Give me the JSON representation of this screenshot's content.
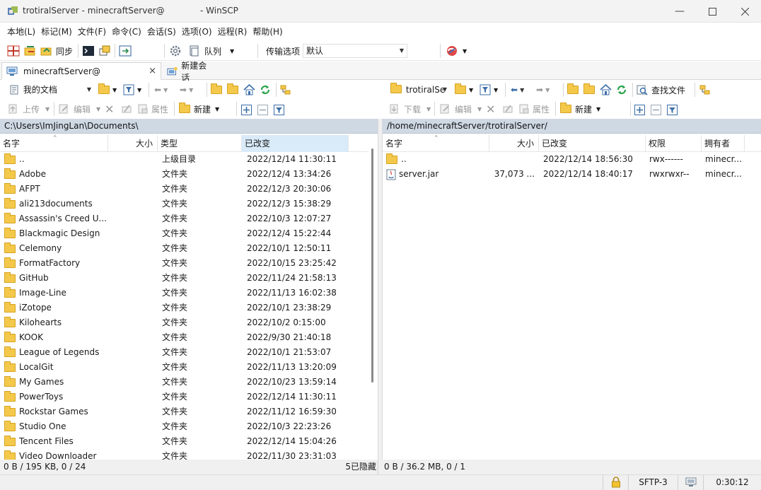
{
  "window": {
    "title_left": "trotiralServer - minecraftServer@",
    "title_right": "- WinSCP"
  },
  "menu": [
    "本地(L)",
    "标记(M)",
    "文件(F)",
    "命令(C)",
    "会话(S)",
    "选项(O)",
    "远程(R)",
    "帮助(H)"
  ],
  "toolbar": {
    "sync_label": "同步",
    "queue_label": "队列",
    "transfer_label": "传输选项",
    "transfer_value": "默认"
  },
  "tabs": {
    "session": "minecraftServer@",
    "close": "×",
    "new_session": "新建会话"
  },
  "local": {
    "location": "我的文档",
    "upload": "上传",
    "edit": "编辑",
    "properties": "属性",
    "new": "新建",
    "path": "C:\\Users\\ImJingLan\\Documents\\",
    "columns": {
      "name": "名字",
      "size": "大小",
      "type": "类型",
      "changed": "已改变"
    },
    "rows": [
      {
        "name": "..",
        "type": "上级目录",
        "changed": "2022/12/14  11:30:11",
        "up": true
      },
      {
        "name": "Adobe",
        "type": "文件夹",
        "changed": "2022/12/4  13:34:26"
      },
      {
        "name": "AFPT",
        "type": "文件夹",
        "changed": "2022/12/3  20:30:06"
      },
      {
        "name": "ali213documents",
        "type": "文件夹",
        "changed": "2022/12/3  15:38:29"
      },
      {
        "name": "Assassin's Creed U...",
        "type": "文件夹",
        "changed": "2022/10/3  12:07:27"
      },
      {
        "name": "Blackmagic Design",
        "type": "文件夹",
        "changed": "2022/12/4  15:22:44"
      },
      {
        "name": "Celemony",
        "type": "文件夹",
        "changed": "2022/10/1  12:50:11"
      },
      {
        "name": "FormatFactory",
        "type": "文件夹",
        "changed": "2022/10/15  23:25:42"
      },
      {
        "name": "GitHub",
        "type": "文件夹",
        "changed": "2022/11/24  21:58:13"
      },
      {
        "name": "Image-Line",
        "type": "文件夹",
        "changed": "2022/11/13  16:02:38"
      },
      {
        "name": "iZotope",
        "type": "文件夹",
        "changed": "2022/10/1  23:38:29"
      },
      {
        "name": "Kilohearts",
        "type": "文件夹",
        "changed": "2022/10/2  0:15:00"
      },
      {
        "name": "KOOK",
        "type": "文件夹",
        "changed": "2022/9/30  21:40:18"
      },
      {
        "name": "League of Legends",
        "type": "文件夹",
        "changed": "2022/10/1  21:53:07"
      },
      {
        "name": "LocalGit",
        "type": "文件夹",
        "changed": "2022/11/13  13:20:09"
      },
      {
        "name": "My Games",
        "type": "文件夹",
        "changed": "2022/10/23  13:59:14"
      },
      {
        "name": "PowerToys",
        "type": "文件夹",
        "changed": "2022/12/14  11:30:11"
      },
      {
        "name": "Rockstar Games",
        "type": "文件夹",
        "changed": "2022/11/12  16:59:30"
      },
      {
        "name": "Studio One",
        "type": "文件夹",
        "changed": "2022/10/3  22:23:26"
      },
      {
        "name": "Tencent Files",
        "type": "文件夹",
        "changed": "2022/12/14  15:04:26"
      },
      {
        "name": "Video Downloader",
        "type": "文件夹",
        "changed": "2022/11/30  23:31:03"
      }
    ],
    "status_left": "0 B / 195 KB,   0 / 24",
    "status_hidden": "5已隐藏"
  },
  "remote": {
    "location": "trotiralSe",
    "find_files": "查找文件",
    "download": "下载",
    "edit": "编辑",
    "properties": "属性",
    "new": "新建",
    "path": "/home/minecraftServer/trotiralServer/",
    "columns": {
      "name": "名字",
      "size": "大小",
      "changed": "已改变",
      "rights": "权限",
      "owner": "拥有者"
    },
    "rows": [
      {
        "name": "..",
        "size": "",
        "changed": "2022/12/14 18:56:30",
        "rights": "rwx------",
        "owner": "minecr...",
        "up": true
      },
      {
        "name": "server.jar",
        "size": "37,073 ...",
        "changed": "2022/12/14 18:40:17",
        "rights": "rwxrwxr--",
        "owner": "minecr...",
        "file": true
      }
    ],
    "status": "0 B / 36.2 MB,   0 / 1"
  },
  "statusbar": {
    "protocol": "SFTP-3",
    "time": "0:30:12"
  }
}
